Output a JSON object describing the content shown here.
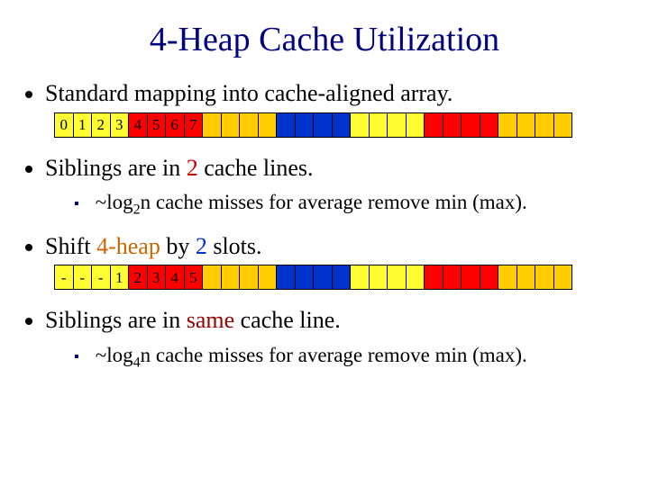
{
  "title": "4-Heap Cache Utilization",
  "bullets": {
    "b1": "Standard mapping into cache-aligned array.",
    "b2_pre": "Siblings are in ",
    "b2_num": "2",
    "b2_post": " cache lines.",
    "b2s_pre": "~log",
    "b2s_sub": "2",
    "b2s_post": "n cache misses for average remove min (max).",
    "b3_pre": "Shift ",
    "b3_mid": "4-heap",
    "b3_post1": " by ",
    "b3_num": "2",
    "b3_post2": " slots.",
    "b4_pre": "Siblings are in ",
    "b4_mid": "same",
    "b4_post": " cache line.",
    "b4s_pre": "~log",
    "b4s_sub": "4",
    "b4s_post": "n cache misses for average remove min (max)."
  },
  "array1": [
    {
      "c": "yellow",
      "t": "0"
    },
    {
      "c": "yellow",
      "t": "1"
    },
    {
      "c": "yellow",
      "t": "2"
    },
    {
      "c": "yellow",
      "t": "3"
    },
    {
      "c": "red",
      "t": "4"
    },
    {
      "c": "red",
      "t": "5"
    },
    {
      "c": "red",
      "t": "6"
    },
    {
      "c": "red",
      "t": "7"
    },
    {
      "c": "orange"
    },
    {
      "c": "orange"
    },
    {
      "c": "orange"
    },
    {
      "c": "orange"
    },
    {
      "c": "blue"
    },
    {
      "c": "blue"
    },
    {
      "c": "blue"
    },
    {
      "c": "blue"
    },
    {
      "c": "yellow"
    },
    {
      "c": "yellow"
    },
    {
      "c": "yellow"
    },
    {
      "c": "yellow"
    },
    {
      "c": "red"
    },
    {
      "c": "red"
    },
    {
      "c": "red"
    },
    {
      "c": "red"
    },
    {
      "c": "orange"
    },
    {
      "c": "orange"
    },
    {
      "c": "orange"
    },
    {
      "c": "orange"
    }
  ],
  "array2": [
    {
      "c": "yellow",
      "t": "-"
    },
    {
      "c": "yellow",
      "t": "-"
    },
    {
      "c": "yellow",
      "t": "-"
    },
    {
      "c": "yellow",
      "t": "1"
    },
    {
      "c": "red",
      "t": "2"
    },
    {
      "c": "red",
      "t": "3"
    },
    {
      "c": "red",
      "t": "4"
    },
    {
      "c": "red",
      "t": "5"
    },
    {
      "c": "orange"
    },
    {
      "c": "orange"
    },
    {
      "c": "orange"
    },
    {
      "c": "orange"
    },
    {
      "c": "blue"
    },
    {
      "c": "blue"
    },
    {
      "c": "blue"
    },
    {
      "c": "blue"
    },
    {
      "c": "yellow"
    },
    {
      "c": "yellow"
    },
    {
      "c": "yellow"
    },
    {
      "c": "yellow"
    },
    {
      "c": "red"
    },
    {
      "c": "red"
    },
    {
      "c": "red"
    },
    {
      "c": "red"
    },
    {
      "c": "orange"
    },
    {
      "c": "orange"
    },
    {
      "c": "orange"
    },
    {
      "c": "orange"
    }
  ]
}
